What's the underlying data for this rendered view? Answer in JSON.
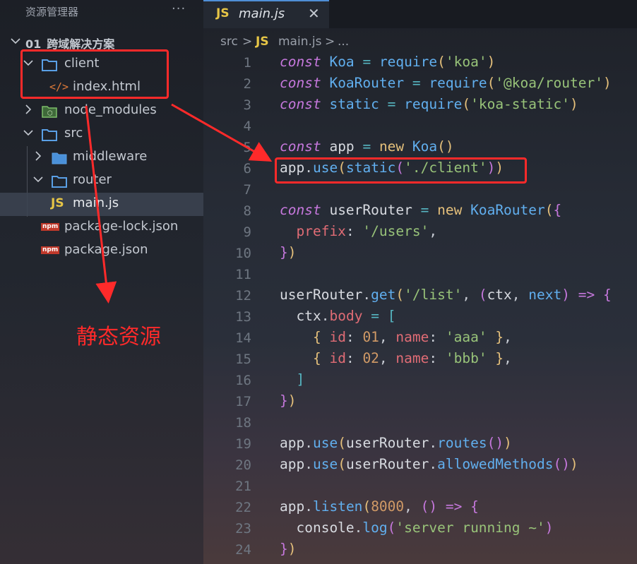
{
  "sidebar": {
    "title": "资源管理器",
    "more": "···",
    "root": "01_跨域解决方案",
    "items": [
      {
        "label": "client"
      },
      {
        "label": "index.html"
      },
      {
        "label": "node_modules"
      },
      {
        "label": "src"
      },
      {
        "label": "middleware"
      },
      {
        "label": "router"
      },
      {
        "label": "main.js"
      },
      {
        "label": "package-lock.json"
      },
      {
        "label": "package.json"
      }
    ],
    "js_badge": "JS",
    "html_badge": "</>",
    "npm_badge": "npm"
  },
  "tab": {
    "badge": "JS",
    "name": "main.js",
    "close": "✕"
  },
  "breadcrumb": {
    "src": "src",
    "sep": ">",
    "badge": "JS",
    "file": "main.js",
    "tail": "..."
  },
  "annotation": "静态资源",
  "colors": {
    "accent": "#4f8fd6",
    "highlight": "#ff2a2a"
  },
  "editor": {
    "line_numbers": [
      "1",
      "2",
      "3",
      "4",
      "5",
      "6",
      "7",
      "8",
      "9",
      "10",
      "11",
      "12",
      "13",
      "14",
      "15",
      "16",
      "17",
      "18",
      "19",
      "20",
      "21",
      "22",
      "23",
      "24"
    ]
  }
}
